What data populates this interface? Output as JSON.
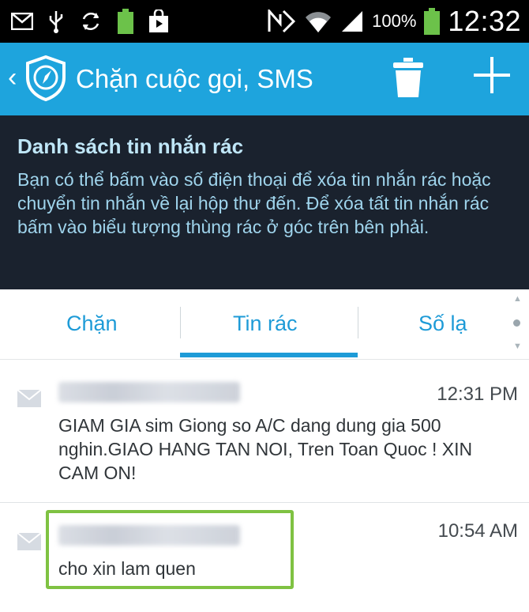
{
  "status_bar": {
    "icons_left": [
      "mail-icon",
      "usb-icon",
      "sync-icon",
      "battery-full-small-icon",
      "store-bag-icon"
    ],
    "icons_right": [
      "nfc-icon",
      "wifi-icon",
      "signal-icon"
    ],
    "battery_text": "100%",
    "time": "12:32"
  },
  "app_bar": {
    "title": "Chặn cuộc gọi, SMS",
    "back_glyph": "‹"
  },
  "banner": {
    "title": "Danh sách tin nhắn rác",
    "description": "Bạn có thể bấm vào số điện thoại để xóa tin nhắn rác hoặc chuyển tin nhắn về lại hộp thư đến. Để xóa tất tin nhắn rác bấm vào biểu tượng thùng rác ở góc trên bên phải."
  },
  "tabs": [
    {
      "label": "Chặn"
    },
    {
      "label": "Tin rác",
      "selected": true
    },
    {
      "label": "Số lạ"
    }
  ],
  "messages": [
    {
      "time": "12:31 PM",
      "body": "GIAM GIA sim Giong so A/C dang dung gia 500 nghin.GIAO HANG TAN NOI, Tren Toan Quoc ! XIN CAM ON!"
    },
    {
      "time": "10:54 AM",
      "body": "cho xin lam quen"
    }
  ],
  "colors": {
    "app_bar": "#1ea4dd",
    "banner": "#1a222e",
    "accent": "#1e9bd7",
    "highlight": "#7fc242"
  }
}
